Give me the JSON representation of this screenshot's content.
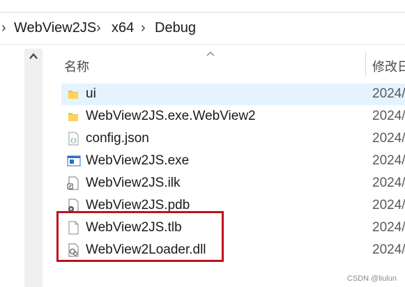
{
  "breadcrumb": {
    "items": [
      "WebView2JS",
      "x64",
      "Debug"
    ]
  },
  "header": {
    "name_col": "名称",
    "date_col": "修改日"
  },
  "files": [
    {
      "name": "ui",
      "date": "2024/",
      "icon": "folder-icon",
      "selected": true
    },
    {
      "name": "WebView2JS.exe.WebView2",
      "date": "2024/",
      "icon": "folder-icon",
      "selected": false
    },
    {
      "name": "config.json",
      "date": "2024/",
      "icon": "json-file-icon",
      "selected": false
    },
    {
      "name": "WebView2JS.exe",
      "date": "2024/",
      "icon": "exe-file-icon",
      "selected": false
    },
    {
      "name": "WebView2JS.ilk",
      "date": "2024/",
      "icon": "ilk-file-icon",
      "selected": false
    },
    {
      "name": "WebView2JS.pdb",
      "date": "2024/",
      "icon": "pdb-file-icon",
      "selected": false
    },
    {
      "name": "WebView2JS.tlb",
      "date": "2024/",
      "icon": "generic-file-icon",
      "selected": false
    },
    {
      "name": "WebView2Loader.dll",
      "date": "2024/",
      "icon": "dll-file-icon",
      "selected": false
    }
  ],
  "watermark": "CSDN @liulun",
  "colors": {
    "selection": "#e5f3ff",
    "highlight_box": "#c0101e",
    "folder": "#f0c24a"
  }
}
